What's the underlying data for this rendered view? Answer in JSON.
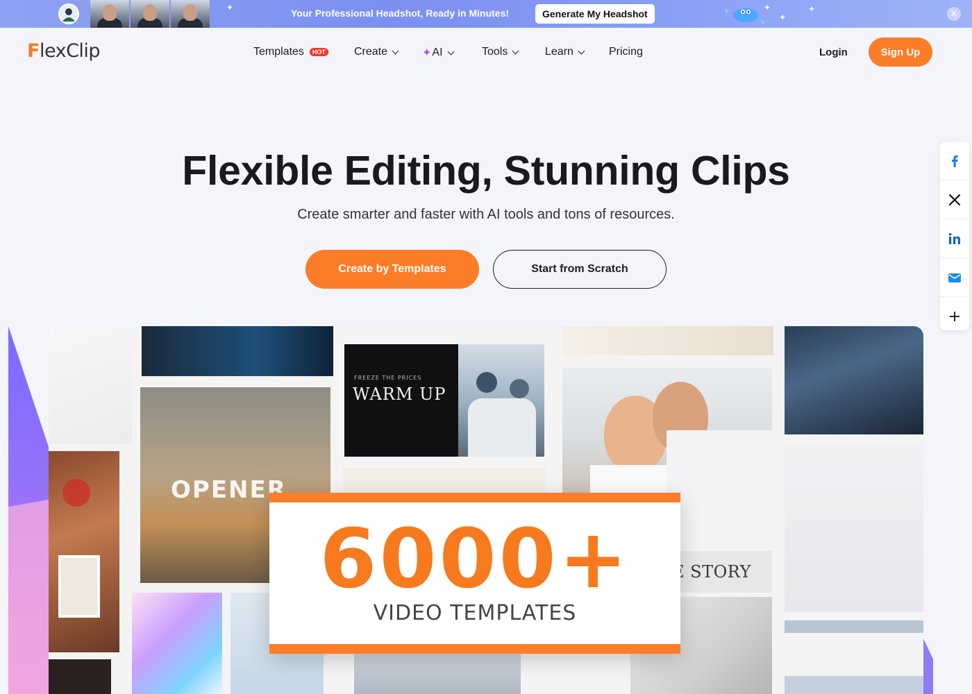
{
  "promo": {
    "text": "Your Professional Headshot, Ready in Minutes!",
    "cta": "Generate My Headshot",
    "close_icon": "close-icon"
  },
  "nav": {
    "logo": "FlexClip",
    "items": [
      {
        "label": "Templates",
        "badge": "HOT"
      },
      {
        "label": "Create"
      },
      {
        "label": "AI"
      },
      {
        "label": "Tools"
      },
      {
        "label": "Learn"
      },
      {
        "label": "Pricing"
      }
    ],
    "login": "Login",
    "signup": "Sign Up"
  },
  "hero": {
    "title": "Flexible Editing, Stunning Clips",
    "subtitle": "Create smarter and faster with AI tools and tons of resources.",
    "primary_cta": "Create by Templates",
    "secondary_cta": "Start from Scratch"
  },
  "share": [
    "facebook-icon",
    "x-icon",
    "linkedin-icon",
    "email-icon",
    "plus-icon"
  ],
  "showcase": {
    "tile_labels": {
      "warmup_small": "FREEZE THE PRICES",
      "warmup": "WARM UP",
      "opener": "OPENER",
      "love_story": "LOVE STORY"
    },
    "badge_number": "6000+",
    "badge_caption": "VIDEO TEMPLATES"
  },
  "colors": {
    "accent": "#fb7d28",
    "promo_bg": "#8ea3f3",
    "hot_badge": "#f5352b",
    "ai_star": "#c144ff"
  }
}
